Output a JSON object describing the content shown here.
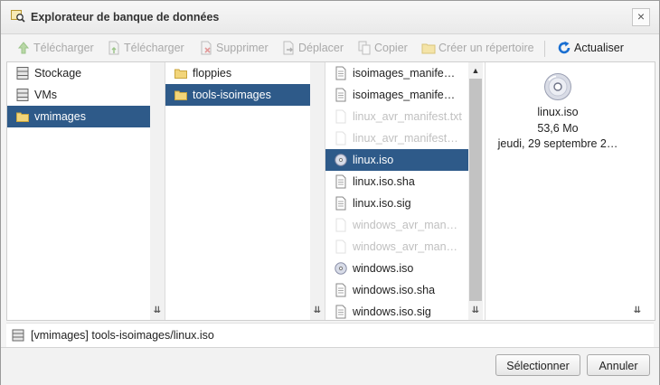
{
  "window": {
    "title": "Explorateur de banque de données",
    "close_glyph": "×"
  },
  "toolbar": {
    "upload_file": "Télécharger",
    "upload_folder": "Télécharger",
    "delete": "Supprimer",
    "move": "Déplacer",
    "copy": "Copier",
    "new_folder": "Créer un répertoire",
    "refresh": "Actualiser"
  },
  "columns": {
    "datastores": [
      {
        "label": "Stockage",
        "icon": "storage-icon"
      },
      {
        "label": "VMs",
        "icon": "storage-icon"
      },
      {
        "label": "vmimages",
        "icon": "folder-icon",
        "selected": true
      }
    ],
    "folders": [
      {
        "label": "floppies",
        "icon": "folder-icon"
      },
      {
        "label": "tools-isoimages",
        "icon": "folder-icon",
        "selected": true
      }
    ],
    "files": [
      {
        "label": "isoimages_manife…",
        "icon": "file-icon"
      },
      {
        "label": "isoimages_manife…",
        "icon": "file-icon"
      },
      {
        "label": "linux_avr_manifest.txt",
        "icon": "file-icon",
        "dim": true
      },
      {
        "label": "linux_avr_manifest…",
        "icon": "file-icon",
        "dim": true
      },
      {
        "label": "linux.iso",
        "icon": "disc-icon",
        "selected": true
      },
      {
        "label": "linux.iso.sha",
        "icon": "file-icon"
      },
      {
        "label": "linux.iso.sig",
        "icon": "file-icon"
      },
      {
        "label": "windows_avr_man…",
        "icon": "file-icon",
        "dim": true
      },
      {
        "label": "windows_avr_man…",
        "icon": "file-icon",
        "dim": true
      },
      {
        "label": "windows.iso",
        "icon": "disc-icon"
      },
      {
        "label": "windows.iso.sha",
        "icon": "file-icon"
      },
      {
        "label": "windows.iso.sig",
        "icon": "file-icon"
      }
    ]
  },
  "preview": {
    "name": "linux.iso",
    "size": "53,6 Mo",
    "date": "jeudi, 29 septembre 2…"
  },
  "pathbar": {
    "path": "[vmimages] tools-isoimages/linux.iso"
  },
  "buttons": {
    "select": "Sélectionner",
    "cancel": "Annuler"
  },
  "colors": {
    "selection": "#2e5a89",
    "refresh_accent": "#1a6fd1"
  }
}
